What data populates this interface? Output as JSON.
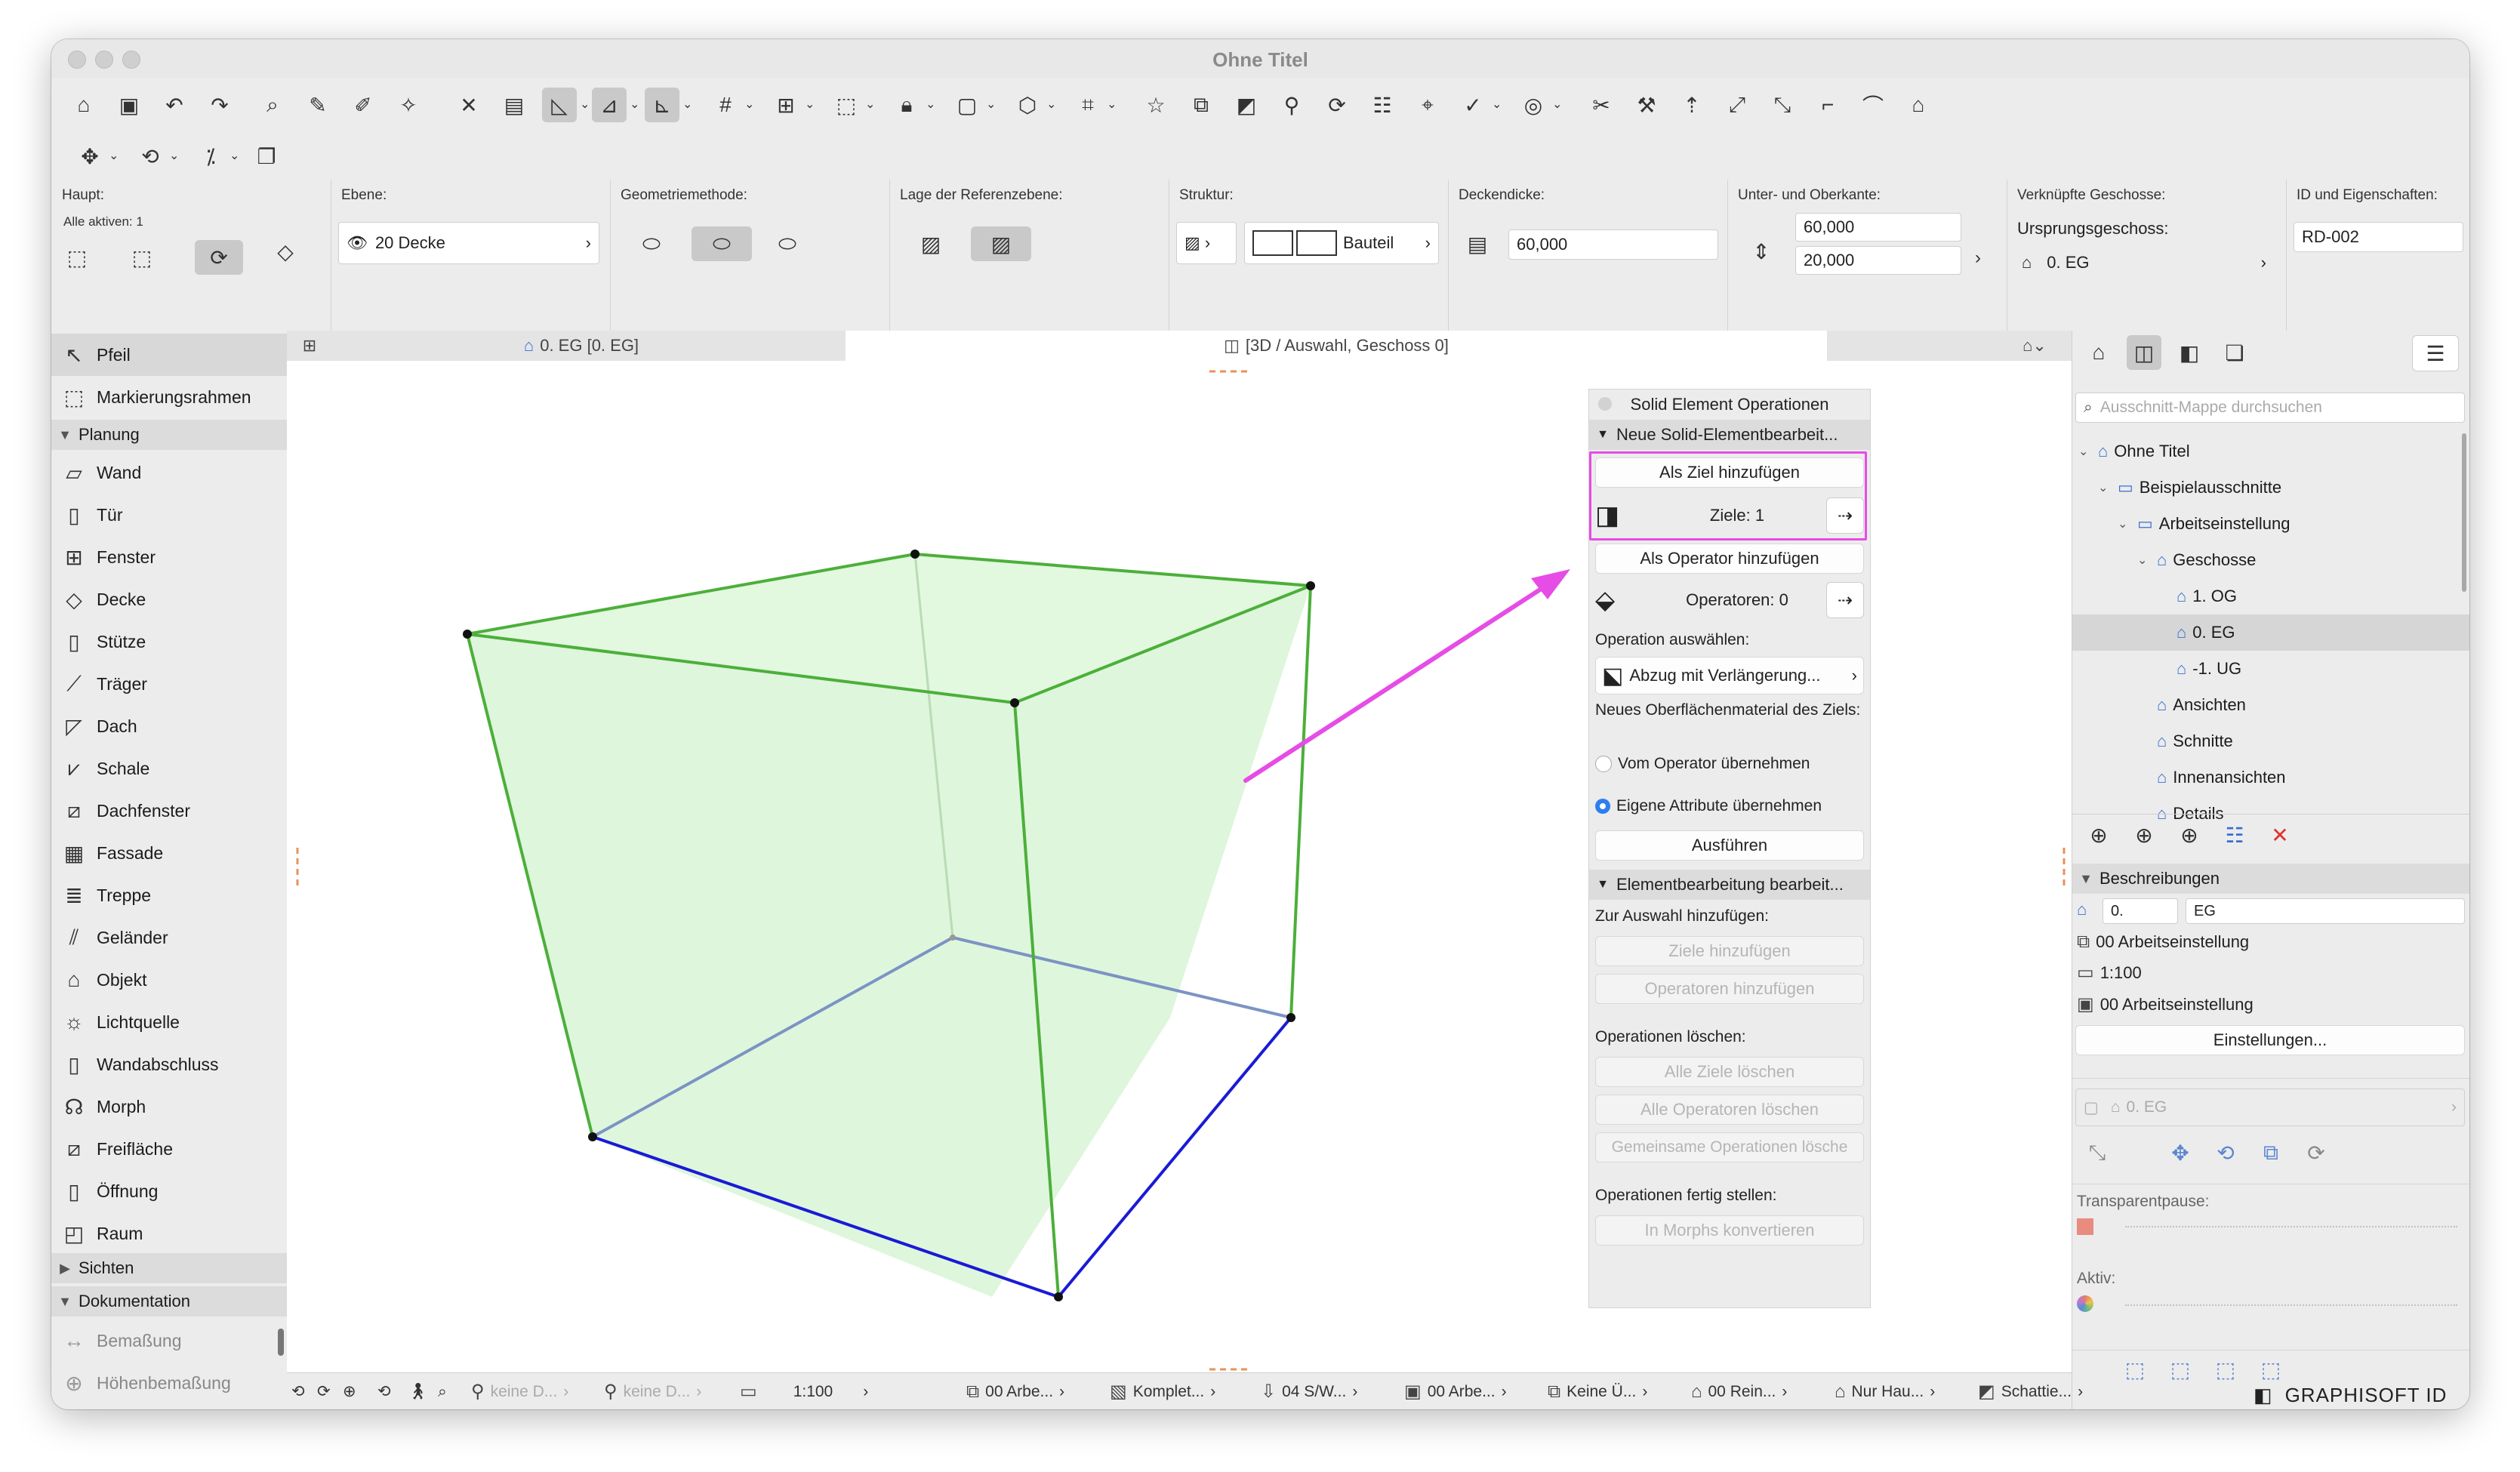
{
  "window": {
    "title": "Ohne Titel"
  },
  "infobox": {
    "haupt_label": "Haupt:",
    "alle_aktiven": "Alle aktiven: 1",
    "ebene_label": "Ebene:",
    "ebene_value": "20 Decke",
    "geometrie_label": "Geometriemethode:",
    "referenz_label": "Lage der Referenzebene:",
    "struktur_label": "Struktur:",
    "struktur_value": "Bauteil",
    "deckendicke_label": "Deckendicke:",
    "deckendicke_value": "60,000",
    "unter_ober_label": "Unter- und Oberkante:",
    "oberkante_value": "60,000",
    "unterkante_value": "20,000",
    "verknuepfte_label": "Verknüpfte Geschosse:",
    "ursprung_label": "Ursprungsgeschoss:",
    "ursprung_value": "0. EG",
    "id_label": "ID und Eigenschaften:",
    "id_value": "RD-002"
  },
  "tabs": [
    {
      "label": "0. EG [0. EG]"
    },
    {
      "label": "[3D / Auswahl, Geschoss 0]"
    }
  ],
  "toolbox": {
    "top_items": [
      {
        "label": "Pfeil",
        "icon": "arrow-icon"
      },
      {
        "label": "Markierungsrahmen",
        "icon": "marquee-icon"
      }
    ],
    "planung_header": "Planung",
    "planung_items": [
      {
        "label": "Wand"
      },
      {
        "label": "Tür"
      },
      {
        "label": "Fenster"
      },
      {
        "label": "Decke"
      },
      {
        "label": "Stütze"
      },
      {
        "label": "Träger"
      },
      {
        "label": "Dach"
      },
      {
        "label": "Schale"
      },
      {
        "label": "Dachfenster"
      },
      {
        "label": "Fassade"
      },
      {
        "label": "Treppe"
      },
      {
        "label": "Geländer"
      },
      {
        "label": "Objekt"
      },
      {
        "label": "Lichtquelle"
      },
      {
        "label": "Wandabschluss"
      },
      {
        "label": "Morph"
      },
      {
        "label": "Freifläche"
      },
      {
        "label": "Öffnung"
      },
      {
        "label": "Raum"
      }
    ],
    "sichten_header": "Sichten",
    "dokumentation_header": "Dokumentation",
    "doku_items": [
      {
        "label": "Bemaßung"
      },
      {
        "label": "Höhenbemaßung"
      }
    ]
  },
  "palette": {
    "title": "Solid Element Operationen",
    "section1": "Neue Solid-Elementbearbeit...",
    "add_target": "Als Ziel hinzufügen",
    "targets": "Ziele: 1",
    "add_operator": "Als Operator hinzufügen",
    "operators": "Operatoren: 0",
    "select_op_label": "Operation auswählen:",
    "operation": "Abzug mit Verlängerung...",
    "new_material_label": "Neues Oberflächenmaterial des Ziels:",
    "radio1": "Vom Operator übernehmen",
    "radio2": "Eigene Attribute übernehmen",
    "execute": "Ausführen",
    "section2": "Elementbearbeitung bearbeit...",
    "add_sel_label": "Zur Auswahl hinzufügen:",
    "add_targets": "Ziele hinzufügen",
    "add_operators": "Operatoren hinzufügen",
    "delete_label": "Operationen löschen:",
    "del_targets": "Alle Ziele löschen",
    "del_operators": "Alle Operatoren löschen",
    "del_common": "Gemeinsame Operationen lösche",
    "finish_label": "Operationen fertig stellen:",
    "convert": "In Morphs konvertieren",
    "highlight_color": "#e64ce6"
  },
  "navigator": {
    "search_placeholder": "Ausschnitt-Mappe durchsuchen",
    "tree": [
      {
        "label": "Ohne Titel",
        "level": 0
      },
      {
        "label": "Beispielausschnitte",
        "level": 1
      },
      {
        "label": "Arbeitseinstellung",
        "level": 2
      },
      {
        "label": "Geschosse",
        "level": 3
      },
      {
        "label": "1. OG",
        "level": 4
      },
      {
        "label": "0. EG",
        "level": 4
      },
      {
        "label": "-1. UG",
        "level": 4
      },
      {
        "label": "Ansichten",
        "level": 3
      },
      {
        "label": "Schnitte",
        "level": 3
      },
      {
        "label": "Innenansichten",
        "level": 3
      },
      {
        "label": "Details",
        "level": 3
      }
    ],
    "beschreibungen_header": "Beschreibungen",
    "desc_num": "0.",
    "desc_name": "EG",
    "layer_combo": "00 Arbeitseinstellung",
    "scale": "1:100",
    "pen_set": "00 Arbeitseinstellung",
    "settings_button": "Einstellungen...",
    "geschoss_field": "0. EG",
    "transparent_label": "Transparentpause:",
    "aktiv_label": "Aktiv:",
    "brand": "GRAPHISOFT ID"
  },
  "statusbar": {
    "nav1": "keine D...",
    "nav2": "keine D...",
    "scale": "1:100",
    "layers": "00 Arbe...",
    "model": "Komplet...",
    "pens": "04 S/W...",
    "view": "00 Arbe...",
    "override": "Keine Ü...",
    "renovation": "00 Rein...",
    "structure": "Nur Hau...",
    "shadow": "Schattie..."
  },
  "colors": {
    "cube_fill": "#d8f5d6",
    "cube_edge": "#4caf3a",
    "cube_hidden": "#7c93c4",
    "cube_bottom": "#1a1ad6",
    "arrow": "#e64ce6"
  }
}
